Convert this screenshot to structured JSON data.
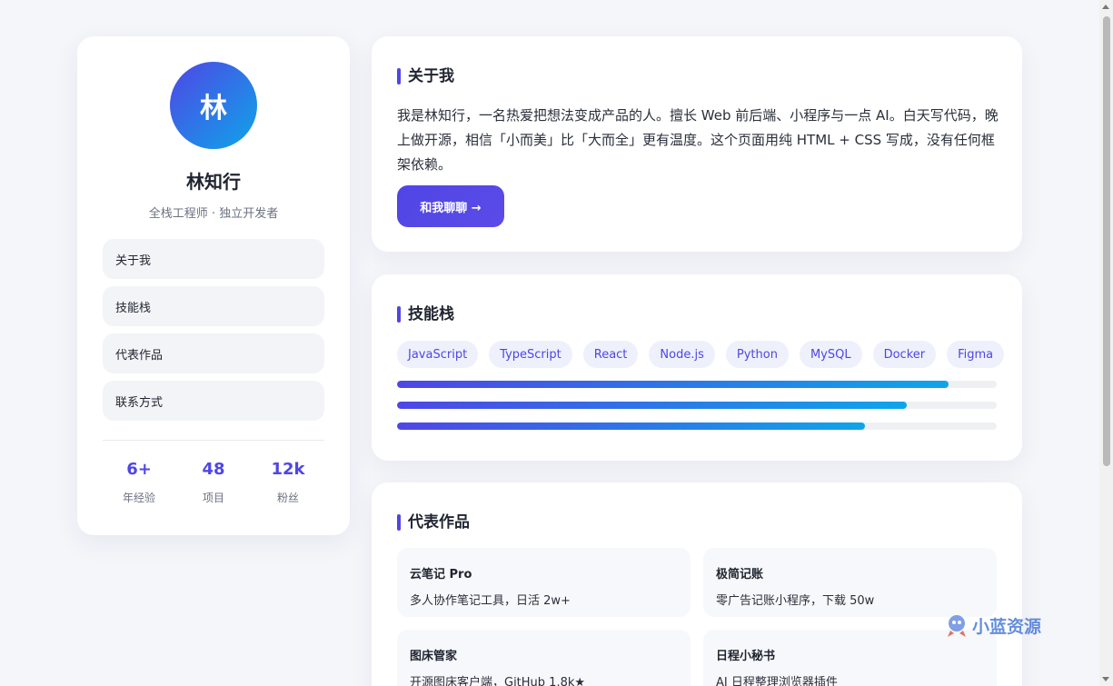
{
  "profile": {
    "avatar_initial": "林",
    "name": "林知行",
    "role": "全栈工程师 · 独立开发者"
  },
  "nav": {
    "items": [
      {
        "label": "关于我"
      },
      {
        "label": "技能栈"
      },
      {
        "label": "代表作品"
      },
      {
        "label": "联系方式"
      }
    ]
  },
  "stats": [
    {
      "value": "6+",
      "label": "年经验"
    },
    {
      "value": "48",
      "label": "项目"
    },
    {
      "value": "12k",
      "label": "粉丝"
    }
  ],
  "about": {
    "title": "关于我",
    "text": "我是林知行，一名热爱把想法变成产品的人。擅长 Web 前后端、小程序与一点 AI。白天写代码，晚上做开源，相信「小而美」比「大而全」更有温度。这个页面用纯 HTML + CSS 写成，没有任何框架依赖。",
    "cta_label": "和我聊聊 →"
  },
  "skills": {
    "title": "技能栈",
    "tags": [
      "JavaScript",
      "TypeScript",
      "React",
      "Node.js",
      "Python",
      "MySQL",
      "Docker",
      "Figma"
    ],
    "levels": [
      0.92,
      0.85,
      0.78
    ]
  },
  "works": {
    "title": "代表作品",
    "items": [
      {
        "title": "云笔记 Pro",
        "desc": "多人协作笔记工具，日活 2w+"
      },
      {
        "title": "极简记账",
        "desc": "零广告记账小程序，下载 50w"
      },
      {
        "title": "图床管家",
        "desc": "开源图床客户端，GitHub 1.8k★"
      },
      {
        "title": "日程小秘书",
        "desc": "AI 日程整理浏览器插件"
      }
    ]
  },
  "watermark": {
    "text": "小蓝资源"
  },
  "colors": {
    "accent": "#4f46e5",
    "accent_end": "#0ea5e9",
    "page_bg": "#f5f6fa"
  }
}
